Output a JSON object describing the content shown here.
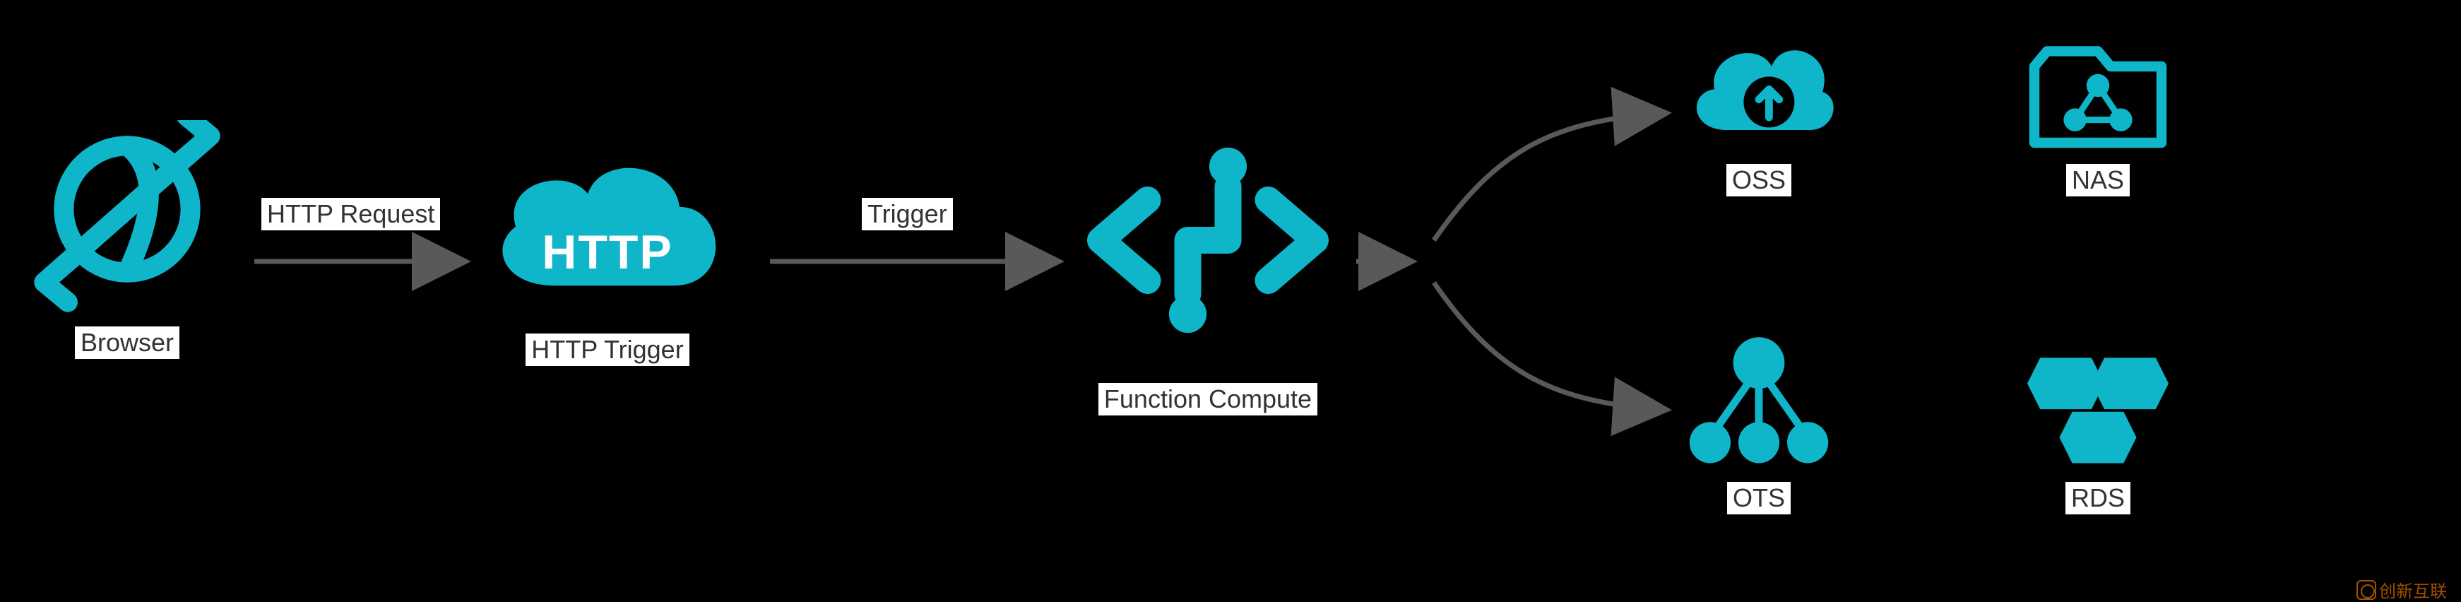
{
  "nodes": {
    "browser": {
      "label": "Browser"
    },
    "http_trigger": {
      "label": "HTTP Trigger",
      "cloud_text": "HTTP"
    },
    "function_compute": {
      "label": "Function Compute"
    },
    "oss": {
      "label": "OSS"
    },
    "nas": {
      "label": "NAS"
    },
    "ots": {
      "label": "OTS"
    },
    "rds": {
      "label": "RDS"
    }
  },
  "edges": {
    "browser_to_trigger": {
      "label": "HTTP Request"
    },
    "trigger_to_function": {
      "label": "Trigger"
    }
  },
  "colors": {
    "accent": "#0fb6c9",
    "arrow": "#595959",
    "bg": "#000000",
    "label_bg": "#ffffff"
  },
  "watermark": "创新互联"
}
